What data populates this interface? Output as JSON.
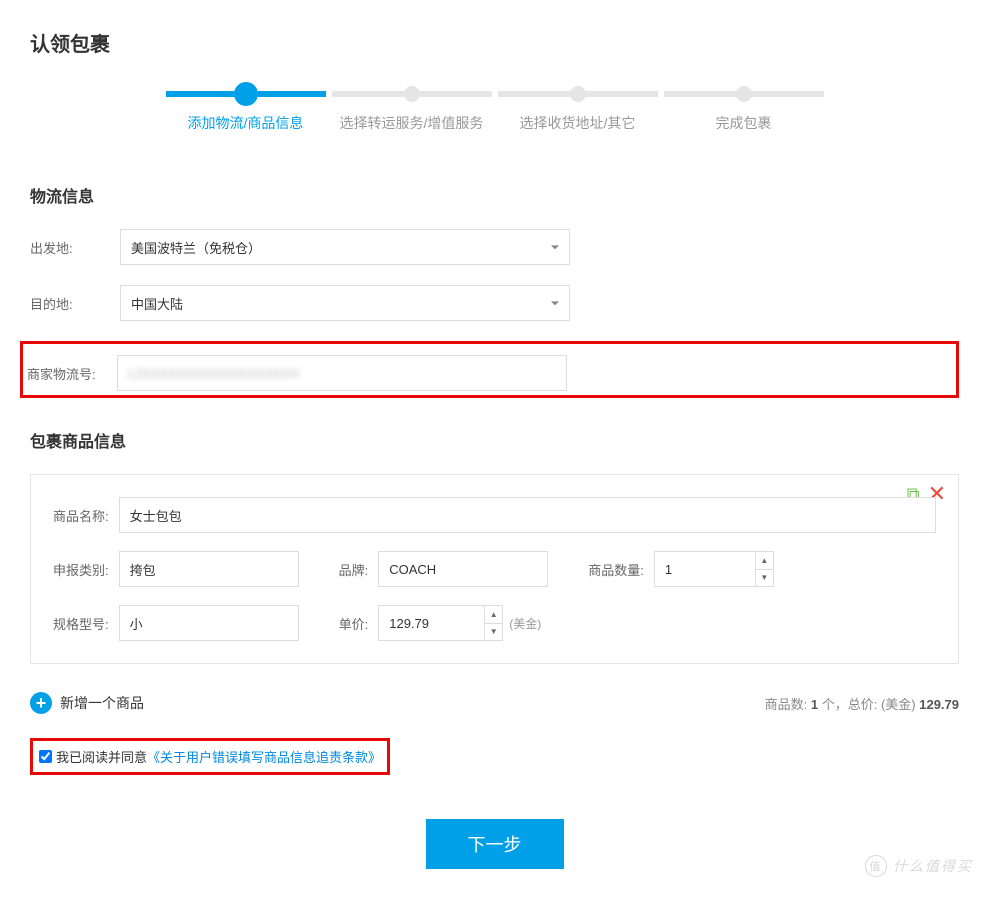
{
  "pageTitle": "认领包裹",
  "stepper": [
    {
      "label": "添加物流/商品信息",
      "active": true
    },
    {
      "label": "选择转运服务/增值服务",
      "active": false
    },
    {
      "label": "选择收货地址/其它",
      "active": false
    },
    {
      "label": "完成包裹",
      "active": false
    }
  ],
  "logistics": {
    "title": "物流信息",
    "originLabel": "出发地:",
    "originValue": "美国波特兰（免税仓）",
    "destLabel": "目的地:",
    "destValue": "中国大陆",
    "trackingLabel": "商家物流号:",
    "trackingValue": "LZXXXXXXXXXXXXXXXXXX"
  },
  "productSection": {
    "title": "包裹商品信息",
    "nameLabel": "商品名称:",
    "nameValue": "女士包包",
    "categoryLabel": "申报类别:",
    "categoryValue": "挎包",
    "brandLabel": "品牌:",
    "brandValue": "COACH",
    "qtyLabel": "商品数量:",
    "qtyValue": "1",
    "specLabel": "规格型号:",
    "specValue": "小",
    "priceLabel": "单价:",
    "priceValue": "129.79",
    "currencyHint": "(美金)"
  },
  "addProductLabel": "新增一个商品",
  "summary": {
    "prefix": "商品数: ",
    "countVal": "1",
    "countUnit": " 个，",
    "totalLabel": "总价: (美金) ",
    "totalValue": "129.79"
  },
  "agreement": {
    "prefix": "我已阅读并同意",
    "linkText": "《关于用户错误填写商品信息追责条款》"
  },
  "nextBtn": "下一步",
  "watermark": {
    "icon": "值",
    "text": "什么值得买"
  }
}
